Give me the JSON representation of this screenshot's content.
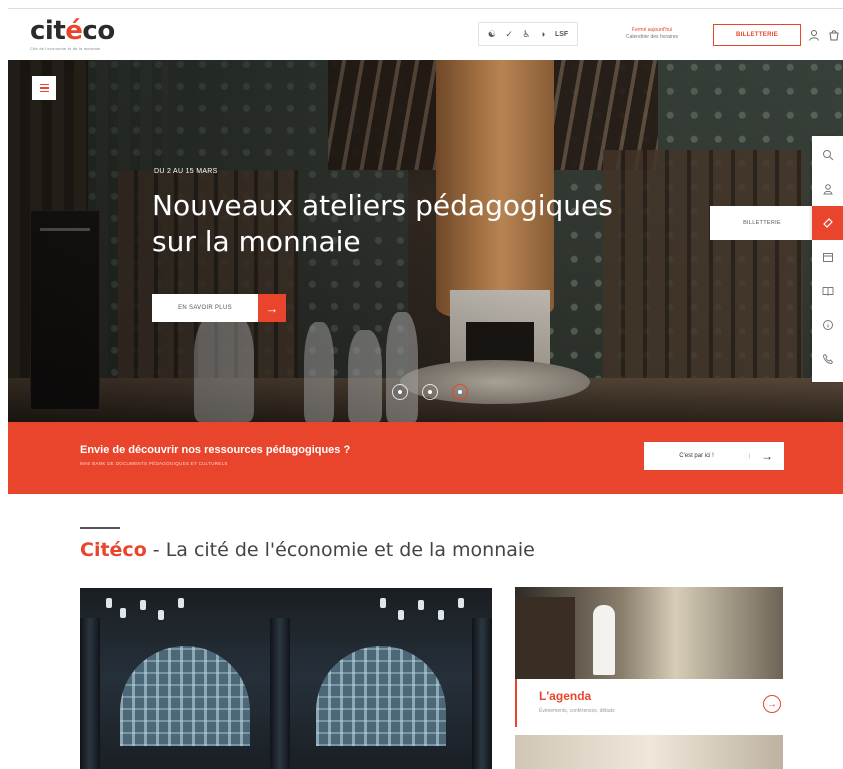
{
  "header": {
    "logo_text": "citéco",
    "logo_tagline": "Cité de l'économie et de la monnaie",
    "accessibility": {
      "lsf_label": "LSF"
    },
    "hours_line1": "Fermé aujourd'hui",
    "hours_line2": "Calendrier des horaires",
    "billetterie_label": "BILLETTERIE"
  },
  "hero": {
    "kicker": "DU 2 AU 15 MARS",
    "title": "Nouveaux ateliers pédagogiques sur la monnaie",
    "cta_label": "EN SAVOIR PLUS",
    "billetterie_label": "BILLETTERIE",
    "slides": 3,
    "active_slide": 3
  },
  "side_rail": {
    "items": [
      {
        "icon": "search-icon"
      },
      {
        "icon": "user-icon"
      },
      {
        "icon": "ticket-icon",
        "active": true
      },
      {
        "icon": "calendar-icon"
      },
      {
        "icon": "book-icon"
      },
      {
        "icon": "info-icon"
      },
      {
        "icon": "phone-icon"
      }
    ]
  },
  "banner": {
    "title": "Envie de découvrir nos ressources pédagogiques ?",
    "subtitle": "MAE BANK DE DOCUMENTS PÉDAGOGIQUES ET CULTURELS",
    "cta_label": "C'est par ici !"
  },
  "section": {
    "brand": "Citéco",
    "separator": " - ",
    "title": "La cité de l'économie et de la monnaie"
  },
  "agenda_card": {
    "title": "L'agenda",
    "subtitle": "Événements, conférences, débats"
  },
  "colors": {
    "accent": "#e8452c",
    "text_dark": "#333333",
    "white": "#ffffff"
  }
}
